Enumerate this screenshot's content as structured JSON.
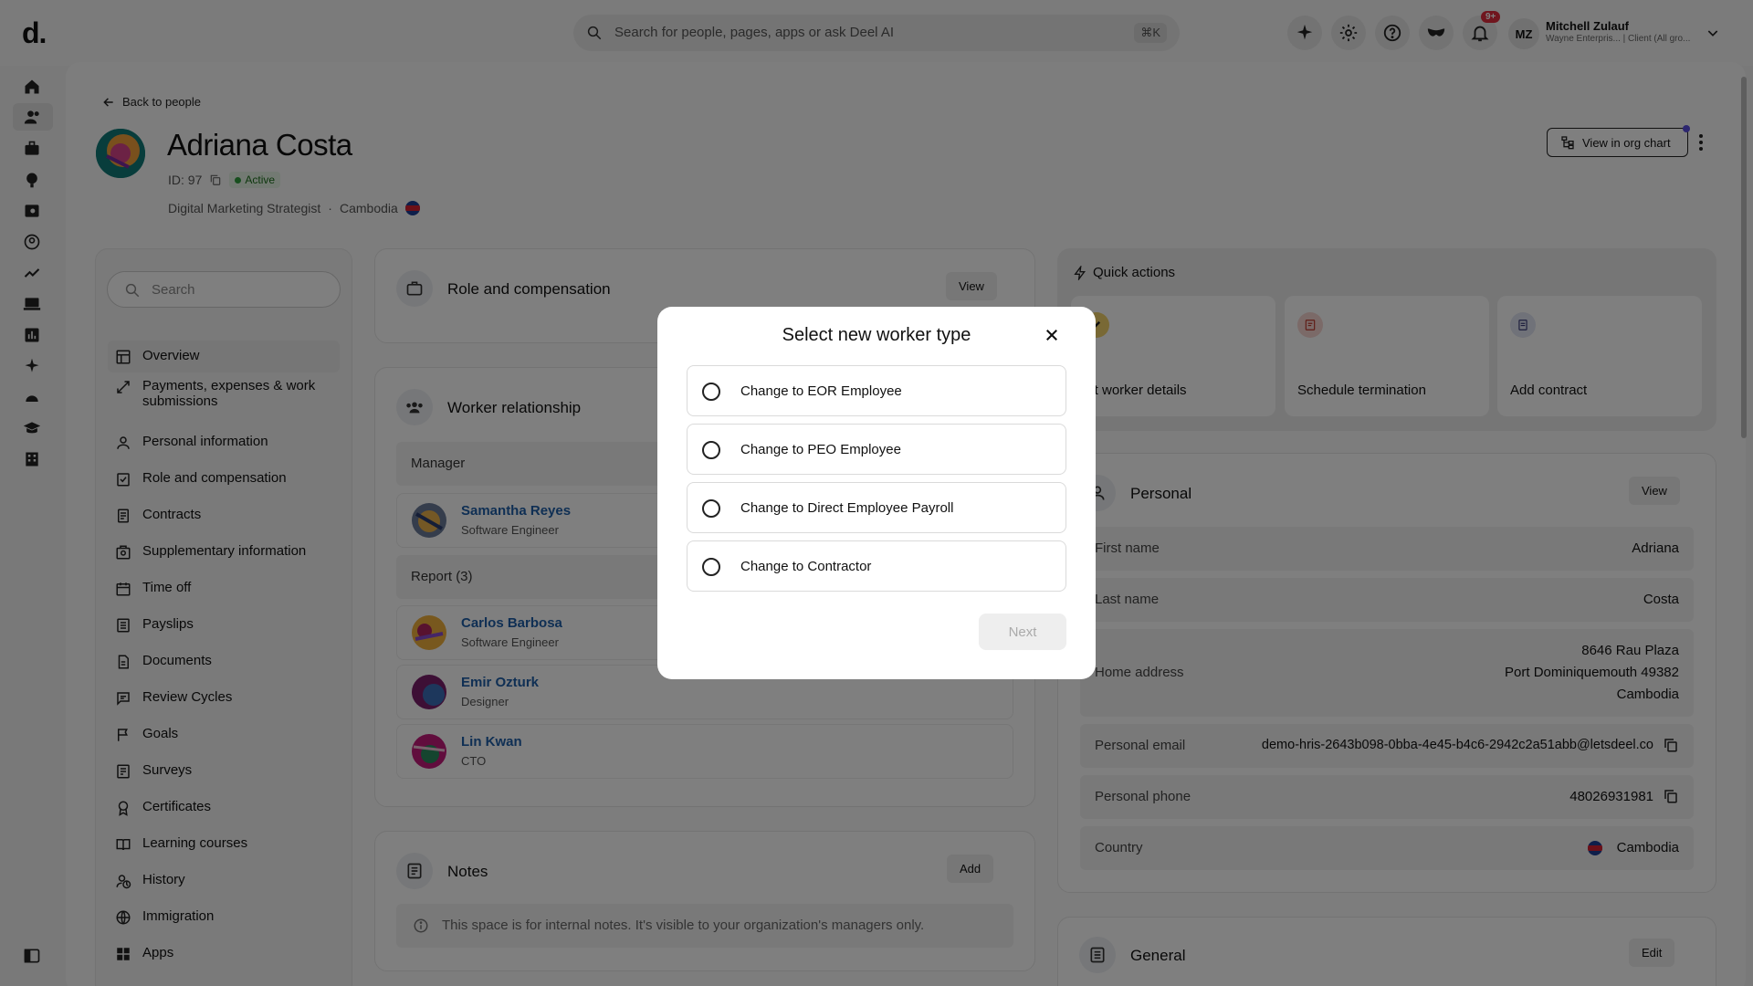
{
  "topbar": {
    "logo": "d.",
    "search_placeholder": "Search for people, pages, apps or ask Deel AI",
    "search_shortcut": "⌘K",
    "notifications_badge": "9+",
    "user_initials": "MZ",
    "user_name": "Mitchell Zulauf",
    "user_sub": "Wayne Enterpris... | Client (All gro..."
  },
  "header": {
    "back_label": "Back to people",
    "name": "Adriana Costa",
    "id_label": "ID: 97",
    "status": "Active",
    "job_title": "Digital Marketing Strategist",
    "country": "Cambodia",
    "org_chart_label": "View in org chart"
  },
  "left_nav": {
    "search_placeholder": "Search",
    "items": [
      {
        "label": "Overview"
      },
      {
        "label": "Payments, expenses & work submissions"
      },
      {
        "label": "Personal information"
      },
      {
        "label": "Role and compensation"
      },
      {
        "label": "Contracts"
      },
      {
        "label": "Supplementary information"
      },
      {
        "label": "Time off"
      },
      {
        "label": "Payslips"
      },
      {
        "label": "Documents"
      },
      {
        "label": "Review Cycles"
      },
      {
        "label": "Goals"
      },
      {
        "label": "Surveys"
      },
      {
        "label": "Certificates"
      },
      {
        "label": "Learning courses"
      },
      {
        "label": "History"
      },
      {
        "label": "Immigration"
      },
      {
        "label": "Apps"
      }
    ]
  },
  "role_card": {
    "title": "Role and compensation",
    "button": "View"
  },
  "relationship_card": {
    "title": "Worker relationship",
    "manager_header": "Manager",
    "manager": {
      "name": "Samantha Reyes",
      "role": "Software Engineer"
    },
    "report_header": "Report (3)",
    "reports": [
      {
        "name": "Carlos Barbosa",
        "role": "Software Engineer"
      },
      {
        "name": "Emir Ozturk",
        "role": "Designer"
      },
      {
        "name": "Lin Kwan",
        "role": "CTO"
      }
    ]
  },
  "notes_card": {
    "title": "Notes",
    "button": "Add",
    "info": "This space is for internal notes. It's visible to your organization's managers only."
  },
  "quick_actions": {
    "title": "Quick actions",
    "tiles": [
      {
        "label": "dit worker details"
      },
      {
        "label": "Schedule termination"
      },
      {
        "label": "Add contract"
      }
    ]
  },
  "personal_card": {
    "title": "Personal",
    "button": "View",
    "first_name_label": "First name",
    "first_name": "Adriana",
    "last_name_label": "Last name",
    "last_name": "Costa",
    "address_label": "Home address",
    "address_line1": "8646 Rau Plaza",
    "address_line2": "Port Dominiquemouth 49382",
    "address_line3": "Cambodia",
    "email_label": "Personal email",
    "email": "demo-hris-2643b098-0bba-4e45-b4c6-2942c2a51abb@letsdeel.co",
    "phone_label": "Personal phone",
    "phone": "48026931981",
    "country_label": "Country",
    "country": "Cambodia"
  },
  "general_card": {
    "title": "General",
    "button": "Edit"
  },
  "modal": {
    "title": "Select new worker type",
    "options": [
      {
        "label": "Change to EOR Employee"
      },
      {
        "label": "Change to PEO Employee"
      },
      {
        "label": "Change to Direct Employee Payroll"
      },
      {
        "label": "Change to Contractor"
      }
    ],
    "next_label": "Next"
  }
}
